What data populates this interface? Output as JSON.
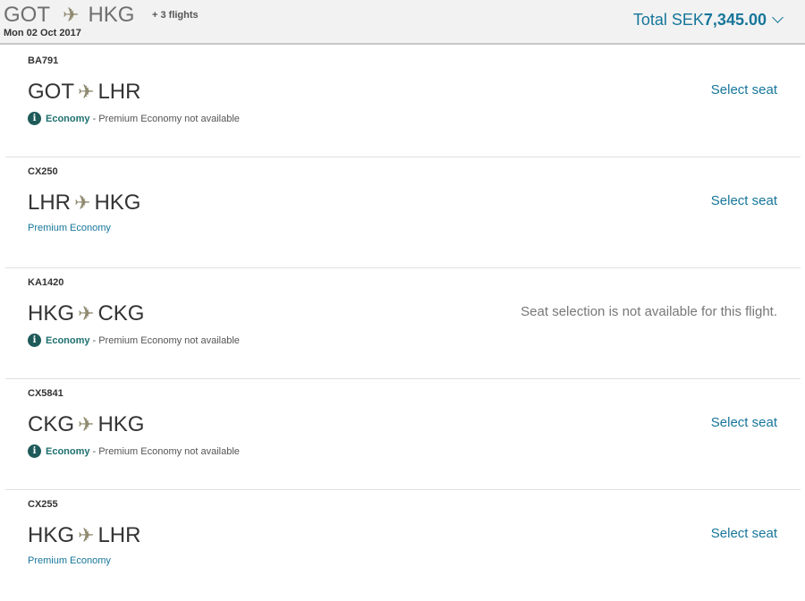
{
  "header": {
    "origin": "GOT",
    "destination": "HKG",
    "more_flights": "+ 3 flights",
    "date": "Mon 02 Oct 2017",
    "total_label": "Total SEK",
    "total_amount": "7,345.00"
  },
  "icons": {
    "plane": "plane-icon",
    "info": "info-icon",
    "chevron": "chevron-down-icon"
  },
  "segments": [
    {
      "flight_no": "BA791",
      "from": "GOT",
      "to": "LHR",
      "cabin": "Economy",
      "cabin_note": "Premium Economy not available",
      "action": "Select seat"
    },
    {
      "flight_no": "CX250",
      "from": "LHR",
      "to": "HKG",
      "cabin": "Premium Economy",
      "action": "Select seat"
    },
    {
      "flight_no": "KA1420",
      "from": "HKG",
      "to": "CKG",
      "cabin": "Economy",
      "cabin_note": "Premium Economy not available",
      "unavailable_text": "Seat selection is not available for this flight."
    },
    {
      "flight_no": "CX5841",
      "from": "CKG",
      "to": "HKG",
      "cabin": "Economy",
      "cabin_note": "Premium Economy not available",
      "action": "Select seat"
    },
    {
      "flight_no": "CX255",
      "from": "HKG",
      "to": "LHR",
      "cabin": "Premium Economy",
      "action": "Select seat"
    }
  ],
  "colors": {
    "accent": "#16769a",
    "economy": "#1e6f6f",
    "plane": "#8f8a6f"
  }
}
